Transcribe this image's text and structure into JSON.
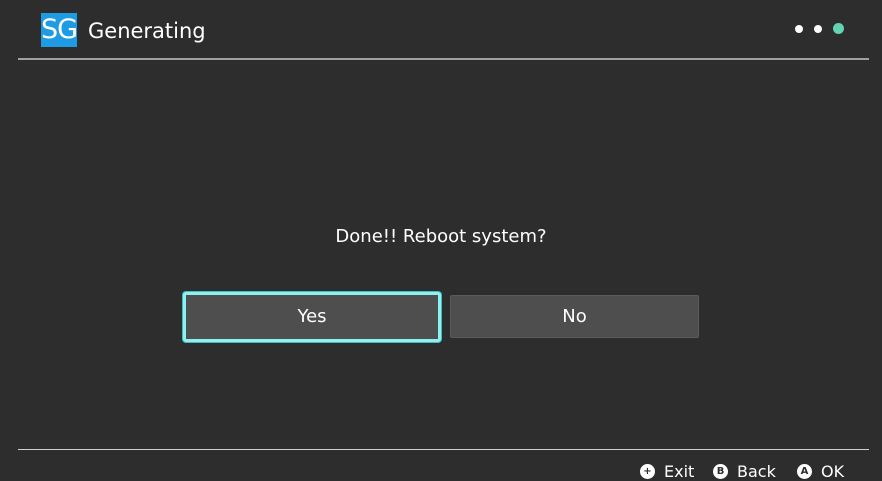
{
  "header": {
    "logo_text": "SG",
    "title": "Generating",
    "page_dots": [
      {
        "active": false
      },
      {
        "active": false
      },
      {
        "active": true
      }
    ],
    "accent_color": "#63d3b2",
    "logo_color": "#1e9be2"
  },
  "dialog": {
    "message": "Done!! Reboot system?",
    "yes_label": "Yes",
    "no_label": "No",
    "selected": "Yes",
    "focus_color": "#8ff0ec"
  },
  "footer": {
    "hints": [
      {
        "icon": "plus-button-icon",
        "glyph": "+",
        "label": "Exit"
      },
      {
        "icon": "b-button-icon",
        "glyph": "B",
        "label": "Back"
      },
      {
        "icon": "a-button-icon",
        "glyph": "A",
        "label": "OK"
      }
    ]
  }
}
